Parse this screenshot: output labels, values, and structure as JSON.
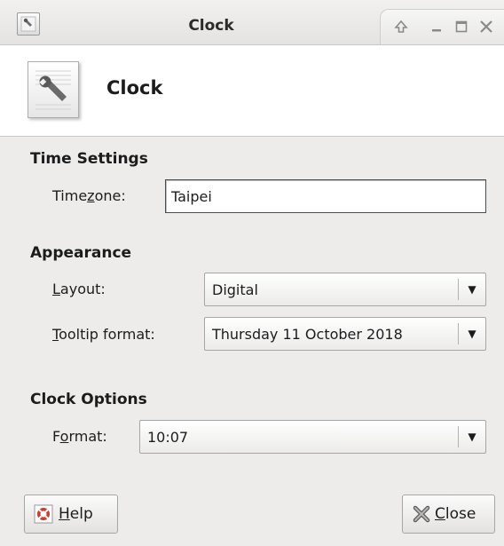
{
  "window": {
    "title": "Clock"
  },
  "header": {
    "title": "Clock"
  },
  "time_settings": {
    "heading": "Time Settings",
    "timezone_label_pre": "Time",
    "timezone_label_u": "z",
    "timezone_label_post": "one:",
    "timezone_value": "Taipei"
  },
  "appearance": {
    "heading": "Appearance",
    "layout_label_u": "L",
    "layout_label_post": "ayout:",
    "layout_value": "Digital",
    "tooltip_label_u": "T",
    "tooltip_label_post": "ooltip format:",
    "tooltip_value": "Thursday 11 October 2018"
  },
  "clock_options": {
    "heading": "Clock Options",
    "format_label_pre": "F",
    "format_label_u": "o",
    "format_label_post": "rmat:",
    "format_value": "10:07"
  },
  "buttons": {
    "help_u": "H",
    "help_post": "elp",
    "close_u": "C",
    "close_post": "lose"
  },
  "icons": {
    "window": "wrench-icon",
    "app": "wrench-icon",
    "help": "lifebuoy-icon",
    "close": "x-icon"
  }
}
